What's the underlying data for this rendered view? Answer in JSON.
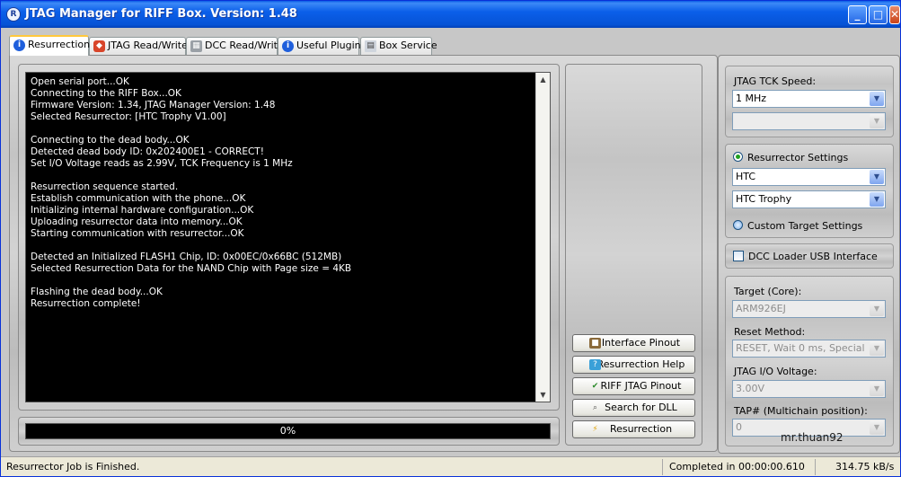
{
  "window": {
    "title": "JTAG Manager for RIFF Box. Version: 1.48",
    "app_icon": "R",
    "buttons": {
      "minimize": "_",
      "maximize": "□",
      "close": "✕"
    }
  },
  "tabs": [
    {
      "label": "Resurrection",
      "icon": "info-icon"
    },
    {
      "label": "JTAG Read/Write",
      "icon": "chip-icon"
    },
    {
      "label": "DCC Read/Write",
      "icon": "dcc-icon"
    },
    {
      "label": "Useful Plugins",
      "icon": "info-icon"
    },
    {
      "label": "Box Service",
      "icon": "document-icon"
    }
  ],
  "log": [
    "Open serial port...OK",
    "Connecting to the RIFF Box...OK",
    "Firmware Version: 1.34, JTAG Manager Version: 1.48",
    "Selected Resurrector: [HTC Trophy V1.00]",
    "",
    "Connecting to the dead body...OK",
    "Detected dead body ID: 0x202400E1 - CORRECT!",
    "Set I/O Voltage reads as 2.99V, TCK Frequency is 1 MHz",
    "",
    "Resurrection sequence started.",
    "Establish communication with the phone...OK",
    "Initializing internal hardware configuration...OK",
    "Uploading resurrector data into memory...OK",
    "Starting communication with resurrector...OK",
    "",
    "Detected an Initialized FLASH1 Chip, ID: 0x00EC/0x66BC (512MB)",
    "Selected Resurrection Data for the NAND Chip with Page size = 4KB",
    "",
    "Flashing the dead body...OK",
    "Resurrection complete!"
  ],
  "progress": {
    "text": "0%",
    "value": 0
  },
  "buttons": {
    "interface_pinout": "Interface Pinout",
    "resurrection_help": "Resurrection Help",
    "riff_jtag_pinout": "RIFF JTAG Pinout",
    "search_dll": "Search for DLL",
    "resurrection": "Resurrection"
  },
  "settings": {
    "tck_label": "JTAG TCK Speed:",
    "tck_value": "1 MHz",
    "tck_value2": "",
    "resurrector_settings_label": "Resurrector Settings",
    "manufacturer": "HTC",
    "model": "HTC Trophy",
    "custom_target_label": "Custom Target Settings",
    "dcc_loader_label": "DCC Loader USB Interface",
    "target_label": "Target (Core):",
    "target_value": "ARM926EJ",
    "reset_label": "Reset Method:",
    "reset_value": "RESET, Wait 0 ms, Special",
    "voltage_label": "JTAG I/O Voltage:",
    "voltage_value": "3.00V",
    "tap_label": "TAP# (Multichain position):",
    "tap_value": "0",
    "watermark": "mr.thuan92"
  },
  "status": {
    "message": "Resurrector Job is Finished.",
    "completed": "Completed in 00:00:00.610",
    "speed": "314.75 kB/s"
  }
}
